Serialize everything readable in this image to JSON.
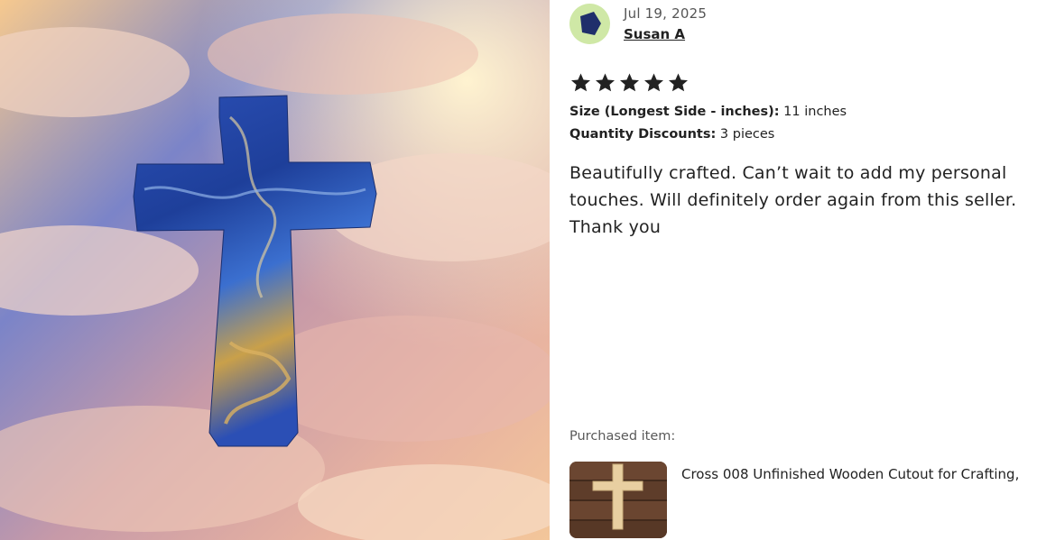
{
  "photo": {
    "alt_icon": "cross-photo"
  },
  "review": {
    "date": "Jul 19, 2025",
    "author": "Susan A",
    "rating": 5,
    "rating_max": 5,
    "attributes": [
      {
        "label": "Size (Longest Side - inches):",
        "value": "11 inches"
      },
      {
        "label": "Quantity Discounts:",
        "value": "3 pieces"
      }
    ],
    "text": "Beautifully crafted. Can’t wait to add my personal touches. Will definitely order again from this seller. Thank you"
  },
  "purchased": {
    "label": "Purchased item:",
    "title": "Cross 008 Unfinished Wooden Cutout for Crafting,"
  },
  "colors": {
    "star": "#222222",
    "avatar_bg": "#cfe8a6",
    "avatar_shape": "#1f2f6b"
  }
}
